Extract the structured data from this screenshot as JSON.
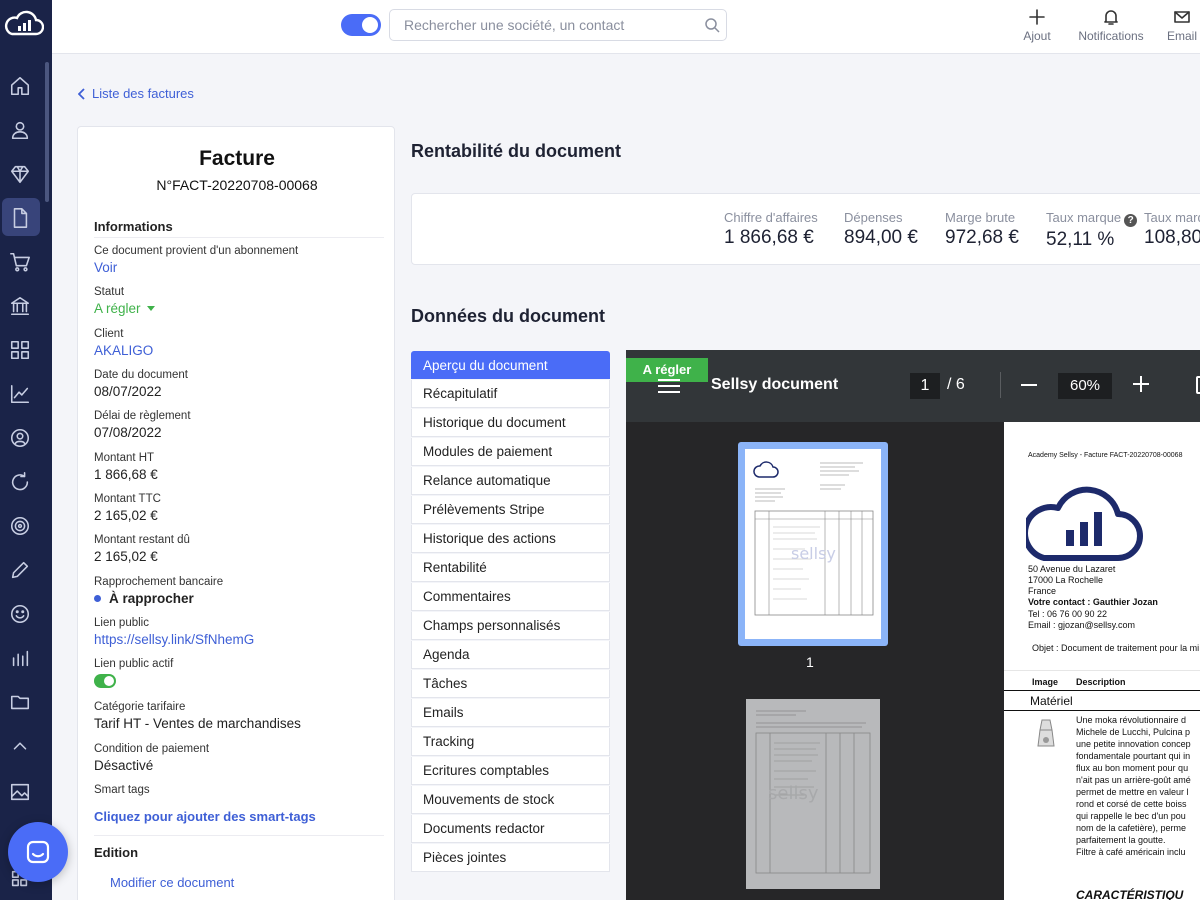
{
  "topbar": {
    "search_placeholder": "Rechercher une société, un contact",
    "actions": [
      {
        "label": "Ajout",
        "icon": "plus-icon"
      },
      {
        "label": "Notifications",
        "icon": "bell-icon"
      },
      {
        "label": "Email",
        "icon": "mail-icon"
      }
    ]
  },
  "breadcrumb": {
    "back_label": "Liste des factures"
  },
  "document": {
    "title": "Facture",
    "number": "N°FACT-20220708-00068",
    "informations_title": "Informations",
    "fields": {
      "abonnement_label": "Ce document provient d'un abonnement",
      "abonnement_link": "Voir",
      "statut_label": "Statut",
      "statut_value": "A régler",
      "client_label": "Client",
      "client_value": "AKALIGO",
      "date_label": "Date du document",
      "date_value": "08/07/2022",
      "delai_label": "Délai de règlement",
      "delai_value": "07/08/2022",
      "ht_label": "Montant HT",
      "ht_value": "1 866,68 €",
      "ttc_label": "Montant TTC",
      "ttc_value": "2 165,02 €",
      "restant_label": "Montant restant dû",
      "restant_value": "2 165,02 €",
      "rapprochement_label": "Rapprochement bancaire",
      "rapprochement_value": "À rapprocher",
      "lien_label": "Lien public",
      "lien_value": "https://sellsy.link/SfNhemG",
      "lien_actif_label": "Lien public actif",
      "categorie_label": "Catégorie tarifaire",
      "categorie_value": "Tarif HT - Ventes de marchandises",
      "condition_label": "Condition de paiement",
      "condition_value": "Désactivé",
      "smart_label": "Smart tags",
      "smart_link": "Cliquez pour ajouter des smart-tags"
    },
    "edition_title": "Edition",
    "edit_link": "Modifier ce document"
  },
  "rentabilite": {
    "title": "Rentabilité du document",
    "kpis": [
      {
        "label": "Chiffre d'affaires",
        "value": "1 866,68 €"
      },
      {
        "label": "Dépenses",
        "value": "894,00 €"
      },
      {
        "label": "Marge brute",
        "value": "972,68 €"
      },
      {
        "label": "Taux marque",
        "value": "52,11 %"
      },
      {
        "label": "Taux marq",
        "value": "108,80"
      }
    ]
  },
  "donnees": {
    "title": "Données du document",
    "menu": [
      "Aperçu du document",
      "Récapitulatif",
      "Historique du document",
      "Modules de paiement",
      "Relance automatique",
      "Prélèvements Stripe",
      "Historique des actions",
      "Rentabilité",
      "Commentaires",
      "Champs personnalisés",
      "Agenda",
      "Tâches",
      "Emails",
      "Tracking",
      "Ecritures comptables",
      "Mouvements de stock",
      "Documents redactor",
      "Pièces jointes"
    ]
  },
  "viewer": {
    "status_tag": "A régler",
    "title": "Sellsy document",
    "page_current": "1",
    "page_total": "/  6",
    "zoom": "60%",
    "thumb_number": "1",
    "page": {
      "header": "Academy Sellsy - Facture FACT-20220708-00068",
      "address1": "50 Avenue du Lazaret",
      "address2": "17000 La Rochelle",
      "address3": "France",
      "contact": "Votre contact : Gauthier Jozan",
      "tel": "Tel : 06 76 00 90 22",
      "email": "Email : gjozan@sellsy.com",
      "objet": "Objet : Document de traitement pour la mi",
      "col_image": "Image",
      "col_desc": "Description",
      "section": "Matériel",
      "desc_lines": [
        "Une moka révolutionnaire d",
        "Michele de Lucchi, Pulcina p",
        "une petite innovation concep",
        "fondamentale pourtant qui in",
        "flux au bon moment pour qu",
        "n'ait pas un arrière-goût amé",
        "permet de mettre en valeur l",
        "rond et corsé de cette boiss",
        "qui rappelle le bec d'un pou",
        "nom de la cafetière), perme",
        "parfaitement la goutte.",
        "Filtre à café américain inclu"
      ],
      "caracteristiques": "CARACTÉRISTIQU"
    }
  },
  "colors": {
    "accent": "#4a6cf7",
    "rail": "#1a2348",
    "green": "#3fb24a",
    "link": "#3e5fd6"
  }
}
